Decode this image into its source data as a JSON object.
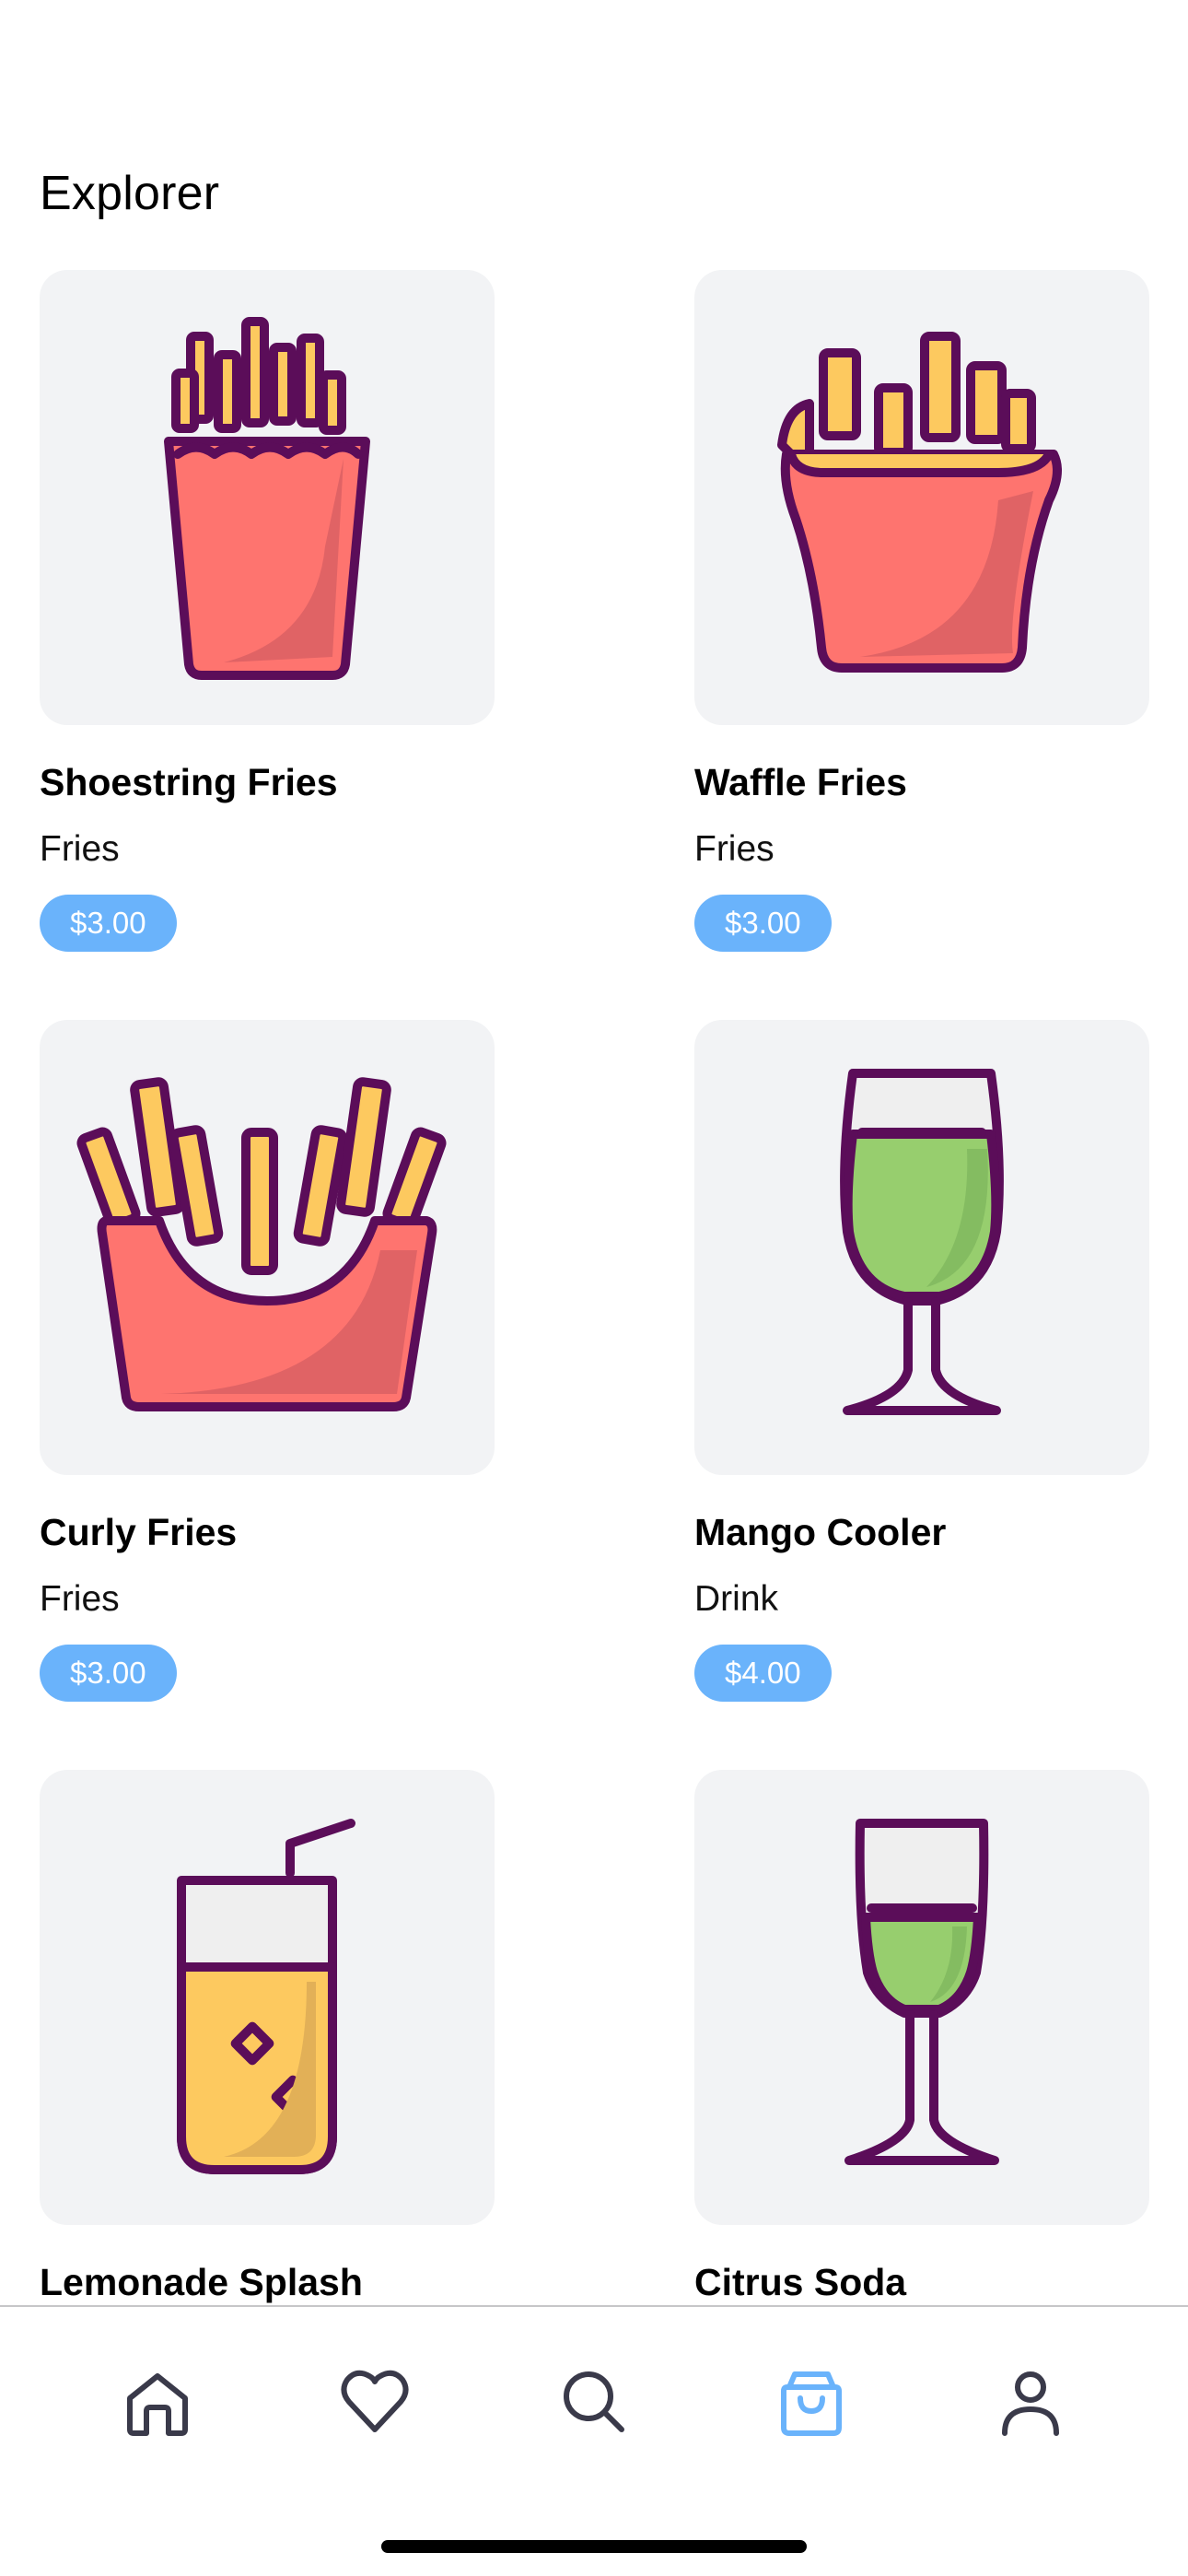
{
  "header": {
    "title": "Explorer"
  },
  "products": [
    {
      "name": "Shoestring Fries",
      "category": "Fries",
      "price": "$3.00",
      "icon": "shoestring-fries-icon"
    },
    {
      "name": "Waffle Fries",
      "category": "Fries",
      "price": "$3.00",
      "icon": "waffle-fries-icon"
    },
    {
      "name": "Curly Fries",
      "category": "Fries",
      "price": "$3.00",
      "icon": "curly-fries-icon"
    },
    {
      "name": "Mango Cooler",
      "category": "Drink",
      "price": "$4.00",
      "icon": "goblet-drink-icon"
    },
    {
      "name": "Lemonade Splash",
      "category": "",
      "price": "",
      "icon": "lemonade-glass-icon"
    },
    {
      "name": "Citrus Soda",
      "category": "",
      "price": "",
      "icon": "tall-glass-drink-icon"
    }
  ],
  "tabbar": {
    "items": [
      {
        "icon": "home-icon",
        "active": false
      },
      {
        "icon": "heart-icon",
        "active": false
      },
      {
        "icon": "search-icon",
        "active": false
      },
      {
        "icon": "shopping-bag-icon",
        "active": true
      },
      {
        "icon": "person-icon",
        "active": false
      }
    ]
  },
  "colors": {
    "accent": "#6ab3fb",
    "card_background": "#f2f3f5",
    "icon_outline": "#5b0d59",
    "fries_yellow": "#fdc95f",
    "cup_red": "#fe746f",
    "drink_green": "#97ce6e",
    "tab_inactive": "#3a3a4a"
  }
}
